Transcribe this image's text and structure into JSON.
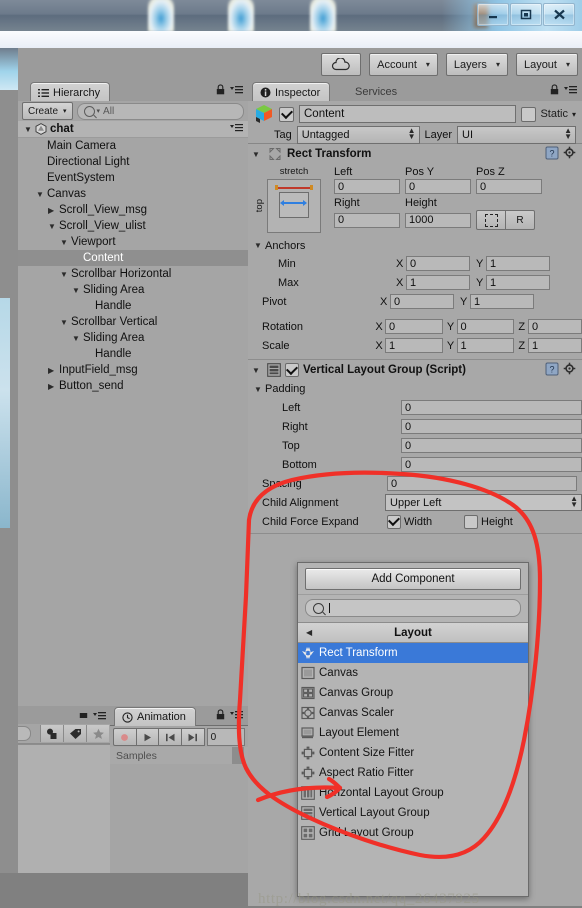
{
  "window": {
    "min_label": "–",
    "max_label": "□",
    "close_label": "✕"
  },
  "toolbar": {
    "cloud_icon": "cloud-icon",
    "account_label": "Account",
    "layers_label": "Layers",
    "layout_label": "Layout",
    "caret": "▾"
  },
  "hierarchy": {
    "tab_label": "Hierarchy",
    "create_label": "Create",
    "create_caret": "▾",
    "search_placeholder": "All",
    "search_value": "All",
    "search_caret": "▾",
    "items": [
      {
        "label": "chat",
        "depth": 0,
        "tri": "▼",
        "root": true,
        "selected": false,
        "unity_icon": true
      },
      {
        "label": "Main Camera",
        "depth": 1,
        "tri": "",
        "root": false,
        "selected": false,
        "unity_icon": false
      },
      {
        "label": "Directional Light",
        "depth": 1,
        "tri": "",
        "root": false,
        "selected": false,
        "unity_icon": false
      },
      {
        "label": "EventSystem",
        "depth": 1,
        "tri": "",
        "root": false,
        "selected": false,
        "unity_icon": false
      },
      {
        "label": "Canvas",
        "depth": 1,
        "tri": "▼",
        "root": false,
        "selected": false,
        "unity_icon": false
      },
      {
        "label": "Scroll_View_msg",
        "depth": 2,
        "tri": "▶",
        "root": false,
        "selected": false,
        "unity_icon": false
      },
      {
        "label": "Scroll_View_ulist",
        "depth": 2,
        "tri": "▼",
        "root": false,
        "selected": false,
        "unity_icon": false
      },
      {
        "label": "Viewport",
        "depth": 3,
        "tri": "▼",
        "root": false,
        "selected": false,
        "unity_icon": false
      },
      {
        "label": "Content",
        "depth": 4,
        "tri": "",
        "root": false,
        "selected": true,
        "unity_icon": false
      },
      {
        "label": "Scrollbar Horizontal",
        "depth": 3,
        "tri": "▼",
        "root": false,
        "selected": false,
        "unity_icon": false
      },
      {
        "label": "Sliding Area",
        "depth": 4,
        "tri": "▼",
        "root": false,
        "selected": false,
        "unity_icon": false
      },
      {
        "label": "Handle",
        "depth": 5,
        "tri": "",
        "root": false,
        "selected": false,
        "unity_icon": false
      },
      {
        "label": "Scrollbar Vertical",
        "depth": 3,
        "tri": "▼",
        "root": false,
        "selected": false,
        "unity_icon": false
      },
      {
        "label": "Sliding Area",
        "depth": 4,
        "tri": "▼",
        "root": false,
        "selected": false,
        "unity_icon": false
      },
      {
        "label": "Handle",
        "depth": 5,
        "tri": "",
        "root": false,
        "selected": false,
        "unity_icon": false
      },
      {
        "label": "InputField_msg",
        "depth": 2,
        "tri": "▶",
        "root": false,
        "selected": false,
        "unity_icon": false
      },
      {
        "label": "Button_send",
        "depth": 2,
        "tri": "▶",
        "root": false,
        "selected": false,
        "unity_icon": false
      }
    ]
  },
  "project_panel": {
    "tool_icons": [
      "object-icon",
      "label-icon",
      "favorite-star-icon"
    ]
  },
  "animation": {
    "tab_label": "Animation",
    "clock_icon": "clock-icon",
    "buttons": [
      {
        "name": "record-button",
        "glyph": "●"
      },
      {
        "name": "play-button",
        "glyph": "▶"
      },
      {
        "name": "prev-frame-button",
        "glyph": "❘◀"
      },
      {
        "name": "next-frame-button",
        "glyph": "▶❘"
      }
    ],
    "frame_value": "0",
    "samples_label": "Samples"
  },
  "inspector": {
    "tab_label": "Inspector",
    "services_tab_label": "Services",
    "info_icon": "info-icon",
    "gameobject": {
      "icon": "gameobject-cube-icon",
      "enabled": true,
      "name": "Content",
      "static_label": "Static",
      "static_checked": false,
      "tag_label": "Tag",
      "tag_value": "Untagged",
      "layer_label": "Layer",
      "layer_value": "UI"
    },
    "rect_transform": {
      "title": "Rect Transform",
      "expanded_tri": "▼",
      "preset_top_label": "stretch",
      "preset_left_label": "top",
      "fields": {
        "left_label": "Left",
        "left_value": "0",
        "posy_label": "Pos Y",
        "posy_value": "0",
        "posz_label": "Pos Z",
        "posz_value": "0",
        "right_label": "Right",
        "right_value": "0",
        "height_label": "Height",
        "height_value": "1000",
        "blueprint_label": "",
        "raw_label": "R"
      },
      "anchors_label": "Anchors",
      "anchors_tri": "▼",
      "min_label": "Min",
      "min_x": "0",
      "min_y": "1",
      "max_label": "Max",
      "max_x": "1",
      "max_y": "1",
      "pivot_label": "Pivot",
      "pivot_x": "0",
      "pivot_y": "1",
      "rotation_label": "Rotation",
      "rot_x": "0",
      "rot_y": "0",
      "rot_z": "0",
      "scale_label": "Scale",
      "scale_x": "1",
      "scale_y": "1",
      "scale_z": "1",
      "axis_x": "X",
      "axis_y": "Y",
      "axis_z": "Z"
    },
    "vertical_layout_group": {
      "title": "Vertical Layout Group (Script)",
      "enabled": true,
      "expanded_tri": "▼",
      "padding_label": "Padding",
      "padding_tri": "▼",
      "left_label": "Left",
      "left_value": "0",
      "right_label": "Right",
      "right_value": "0",
      "top_label": "Top",
      "top_value": "0",
      "bottom_label": "Bottom",
      "bottom_value": "0",
      "spacing_label": "Spacing",
      "spacing_value": "0",
      "child_alignment_label": "Child Alignment",
      "child_alignment_value": "Upper Left",
      "child_force_expand_label": "Child Force Expand",
      "width_label": "Width",
      "width_checked": true,
      "height_label": "Height",
      "height_checked": false
    }
  },
  "add_component": {
    "button_label": "Add Component",
    "search_value": "",
    "search_icon": "search-icon",
    "back_arrow": "◀",
    "category_label": "Layout",
    "items": [
      {
        "label": "Rect Transform",
        "icon": "rect-transform-icon",
        "selected": true
      },
      {
        "label": "Canvas",
        "icon": "canvas-icon",
        "selected": false
      },
      {
        "label": "Canvas Group",
        "icon": "canvas-group-icon",
        "selected": false
      },
      {
        "label": "Canvas Scaler",
        "icon": "canvas-scaler-icon",
        "selected": false
      },
      {
        "label": "Layout Element",
        "icon": "layout-element-icon",
        "selected": false
      },
      {
        "label": "Content Size Fitter",
        "icon": "content-size-fitter-icon",
        "selected": false
      },
      {
        "label": "Aspect Ratio Fitter",
        "icon": "aspect-ratio-fitter-icon",
        "selected": false
      },
      {
        "label": "Horizontal Layout Group",
        "icon": "horizontal-layout-group-icon",
        "selected": false
      },
      {
        "label": "Vertical Layout Group",
        "icon": "vertical-layout-group-icon",
        "selected": false
      },
      {
        "label": "Grid Layout Group",
        "icon": "grid-layout-group-icon",
        "selected": false
      }
    ]
  },
  "watermark": {
    "text": "http://blog.csdn.net/qq_26437925"
  },
  "annotation": {
    "color": "#f03030",
    "shape": "hand-drawn-circle-with-arrow"
  }
}
